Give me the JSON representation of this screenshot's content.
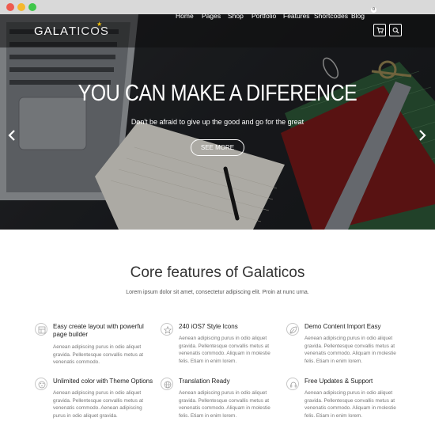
{
  "window": {
    "controls": [
      "close",
      "minimize",
      "maximize"
    ]
  },
  "header": {
    "logo_bold": "GALA",
    "logo_light": "TICOS",
    "nav": [
      {
        "label": "Home"
      },
      {
        "label": "Pages"
      },
      {
        "label": "Shop"
      },
      {
        "label": "Portfolio"
      },
      {
        "label": "Features"
      },
      {
        "label": "Shortcodes"
      },
      {
        "label": "Blog"
      }
    ],
    "cart_count": "0",
    "icons": {
      "cart": "cart-icon",
      "search": "search-icon"
    }
  },
  "hero": {
    "title": "YOU CAN MAKE A DIFERENCE",
    "subtitle": "Don't be afraid to give up the good and go for the great",
    "button_label": "SEE MORE",
    "arrows": {
      "prev": "chevron-left-icon",
      "next": "chevron-right-icon"
    }
  },
  "features_section": {
    "title": "Core features of Galaticos",
    "subtitle": "Lorem ipsum dolor sit amet, consectetur adipiscing elit. Proin at nunc urna.",
    "items": [
      {
        "title": "Easy create layout with powerful page builder",
        "desc": "Aenean adipiscing purus in odio aliquet gravida. Pellentesque convallis metus at venenatis commodo.",
        "icon": "layout-icon"
      },
      {
        "title": "240 iOS7 Style Icons",
        "desc": "Aenean adipiscing purus in odio aliquet gravida. Pellentesque convallis metus at venenatis commodo. Aliquam in molestie felis. Etiam in enim lorem.",
        "icon": "star-icon"
      },
      {
        "title": "Demo Content Import Easy",
        "desc": "Aenean adipiscing purus in odio aliquet gravida. Pellentesque convallis metus at venenatis commodo. Aliquam in molestie felis. Etiam in enim lorem.",
        "icon": "leaf-icon"
      },
      {
        "title": "Unlimited color with Theme Options",
        "desc": "Aenean adipiscing purus in odio aliquet gravida. Pellentesque convallis metus at venenatis commodo. Aenean adipiscing purus in odio aliquet gravida.",
        "icon": "palette-icon"
      },
      {
        "title": "Translation Ready",
        "desc": "Aenean adipiscing purus in odio aliquet gravida. Pellentesque convallis metus at venenatis commodo. Aliquam in molestie felis. Etiam in enim lorem.",
        "icon": "globe-icon"
      },
      {
        "title": "Free Updates & Support",
        "desc": "Aenean adipiscing purus in odio aliquet gravida. Pellentesque convallis metus at venenatis commodo. Aliquam in molestie felis. Etiam in enim lorem.",
        "icon": "support-icon"
      }
    ]
  },
  "colors": {
    "accent_star": "#f4c20d",
    "hero_text": "#ffffff",
    "heading_text": "#333333",
    "body_text": "#777777"
  }
}
